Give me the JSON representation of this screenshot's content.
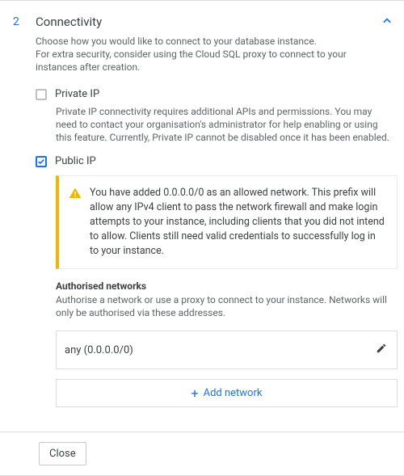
{
  "step_number": "2",
  "title": "Connectivity",
  "description": "Choose how you would like to connect to your database instance.\nFor extra security, consider using the Cloud SQL proxy to connect to your instances after creation.",
  "private_ip": {
    "label": "Private IP",
    "description": "Private IP connectivity requires additional APIs and permissions. You may need to contact your organisation's administrator for help enabling or using this feature. Currently, Private IP cannot be disabled once it has been enabled."
  },
  "public_ip": {
    "label": "Public IP",
    "warning": "You have added 0.0.0.0/0 as an allowed network. This prefix will allow any IPv4 client to pass the network firewall and make login attempts to your instance, including clients that you did not intend to allow. Clients still need valid credentials to successfully log in to your instance.",
    "auth_heading": "Authorised networks",
    "auth_description": "Authorise a network or use a proxy to connect to your instance. Networks will only be authorised via these addresses.",
    "network_entry": "any (0.0.0.0/0)",
    "add_label": "Add network"
  },
  "close_label": "Close"
}
